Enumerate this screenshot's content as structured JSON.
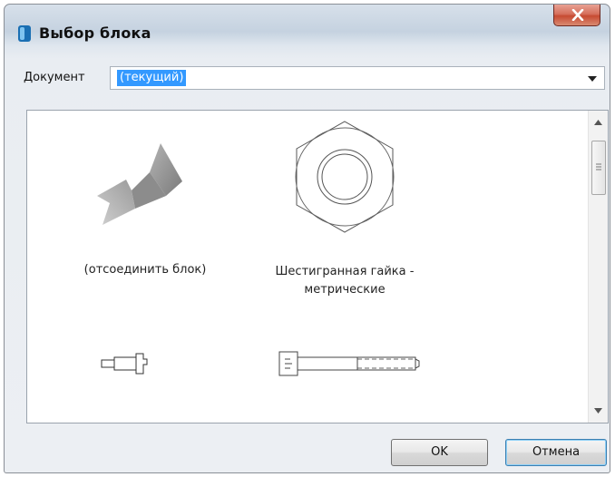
{
  "window": {
    "title": "Выбор блока",
    "close_icon": "close-x-icon"
  },
  "document": {
    "label": "Документ",
    "selected_value": "(текущий)"
  },
  "blocks": [
    {
      "label": "(отсоединить блок)",
      "icon": "detach-block-arrow-icon"
    },
    {
      "label_line1": "Шестигранная гайка -",
      "label_line2": "метрические",
      "icon": "hex-nut-icon"
    },
    {
      "label": "",
      "icon": "small-bolt-icon"
    },
    {
      "label": "",
      "icon": "long-bolt-icon"
    }
  ],
  "buttons": {
    "ok_label": "OK",
    "cancel_label": "Отмена"
  },
  "colors": {
    "selection": "#3399ff",
    "close_button": "#c74b32",
    "default_button_border": "#3c7fb1"
  }
}
